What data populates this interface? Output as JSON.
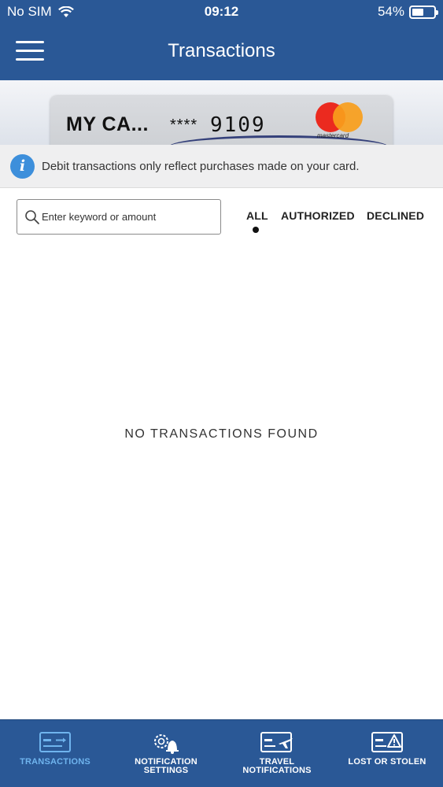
{
  "status_bar": {
    "carrier": "No SIM",
    "time": "09:12",
    "battery_percent": "54%",
    "battery_level": 0.54,
    "wifi_icon": "wifi-icon"
  },
  "header": {
    "title": "Transactions",
    "menu_icon": "hamburger-menu-icon"
  },
  "card": {
    "name": "MY CA...",
    "mask": "****",
    "last4": "9109",
    "network": "mastercard"
  },
  "info_banner": {
    "icon": "info-icon",
    "text": "Debit transactions only reflect purchases made on your card."
  },
  "search": {
    "placeholder": "Enter keyword or amount",
    "value": ""
  },
  "filters": {
    "items": [
      "ALL",
      "AUTHORIZED",
      "DECLINED"
    ],
    "selected": "ALL"
  },
  "empty_state": {
    "text": "NO TRANSACTIONS FOUND"
  },
  "tabbar": {
    "items": [
      {
        "line1": "TRANSACTIONS",
        "line2": "",
        "icon": "card-transactions-icon",
        "active": true
      },
      {
        "line1": "NOTIFICATION",
        "line2": "SETTINGS",
        "icon": "gear-bell-icon",
        "active": false
      },
      {
        "line1": "TRAVEL",
        "line2": "NOTIFICATIONS",
        "icon": "card-plane-icon",
        "active": false
      },
      {
        "line1": "LOST OR STOLEN",
        "line2": "",
        "icon": "card-warning-icon",
        "active": false
      }
    ]
  },
  "colors": {
    "primary_blue": "#2a5896",
    "active_tab": "#6fb4ee",
    "info_blue": "#3d8fdb"
  }
}
